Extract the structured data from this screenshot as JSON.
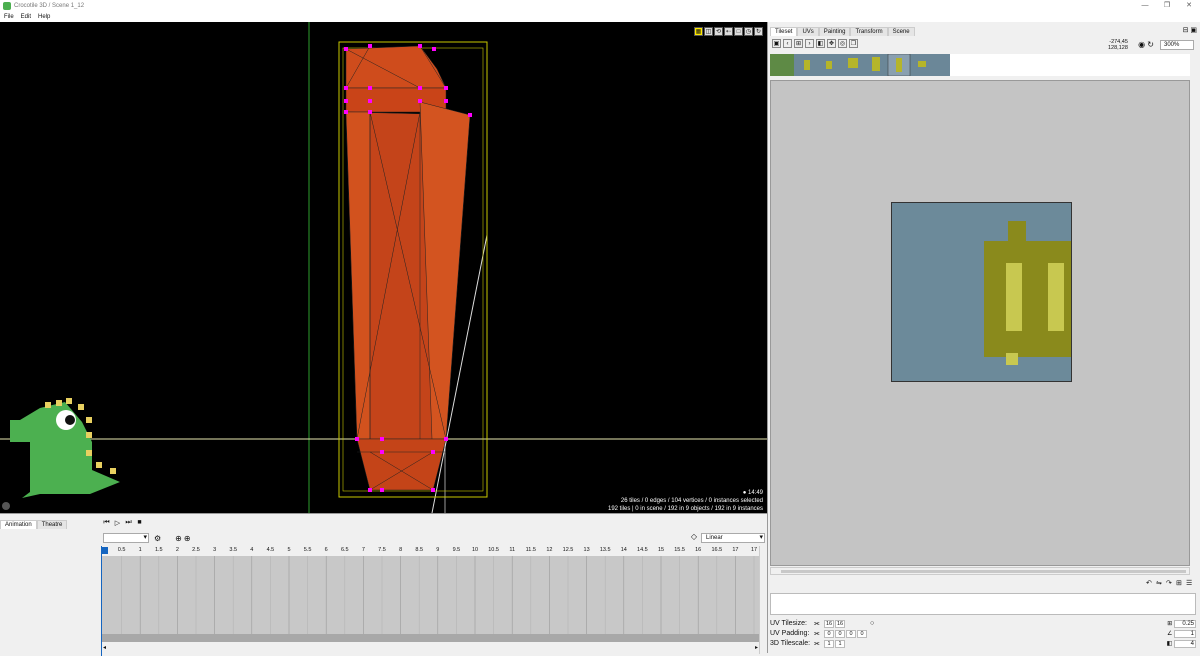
{
  "window": {
    "title": "Crocotile 3D / Scene 1_12",
    "controls": [
      "—",
      "❐",
      "✕"
    ]
  },
  "menu": [
    "File",
    "Edit",
    "Help"
  ],
  "viewport": {
    "toolbar_icons": [
      "grid-icon",
      "camera-icon",
      "rotate-icon",
      "back-icon",
      "box-icon",
      "clock-icon",
      "sync-icon"
    ],
    "clock": "14:49",
    "stats_line1": "26 tiles / 0 edges / 104 vertices / 0 instances selected",
    "stats_line2": "192 tiles | 0 in scene / 192 in 9 objects / 192 in 9 instances"
  },
  "animation": {
    "tabs": [
      "Animation",
      "Theatre"
    ],
    "active_tab": "Animation",
    "controls": [
      "⏮",
      "▷",
      "⏭",
      "■"
    ],
    "interpolation": "Linear",
    "ruler_ticks": [
      "0",
      "0.5",
      "1",
      "1.5",
      "2",
      "2.5",
      "3",
      "3.5",
      "4",
      "4.5",
      "5",
      "5.5",
      "6",
      "6.5",
      "7",
      "7.5",
      "8",
      "8.5",
      "9",
      "9.5",
      "10",
      "10.5",
      "11",
      "11.5",
      "12",
      "12.5",
      "13",
      "13.5",
      "14",
      "14.5",
      "15",
      "15.5",
      "16",
      "16.5",
      "17",
      "17"
    ]
  },
  "right_panel": {
    "tabs": [
      "Tileset",
      "UVs",
      "Painting",
      "Transform",
      "Scene"
    ],
    "active_tab": "Tileset",
    "coords_line1": "-274,45",
    "coords_line2": "128,128",
    "zoom": "300%",
    "uv_tilesize_label": "UV Tilesize:",
    "uv_tilesize": [
      "16",
      "16"
    ],
    "uv_padding_label": "UV Padding:",
    "uv_padding": [
      "0",
      "0",
      "0",
      "0"
    ],
    "tilescale_label": "3D Tilescale:",
    "tilescale": [
      "1",
      "1"
    ],
    "right_values": [
      "0.25",
      "1",
      "4"
    ]
  }
}
